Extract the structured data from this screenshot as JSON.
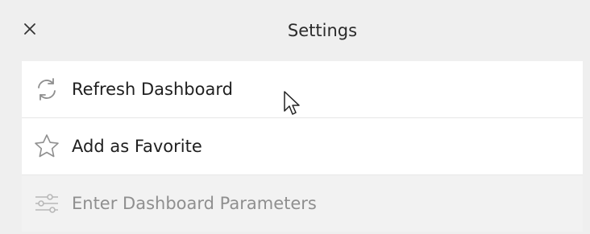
{
  "header": {
    "title": "Settings",
    "close_icon": "close-icon"
  },
  "menu": {
    "items": [
      {
        "label": "Refresh Dashboard",
        "icon": "refresh-icon",
        "enabled": true
      },
      {
        "label": "Add as Favorite",
        "icon": "star-icon",
        "enabled": true
      },
      {
        "label": "Enter Dashboard Parameters",
        "icon": "sliders-icon",
        "enabled": false
      }
    ]
  },
  "colors": {
    "background": "#efefef",
    "item_background": "#ffffff",
    "text": "#1f1f1f",
    "disabled_text": "#8f8f8f",
    "icon": "#8a8a8a"
  }
}
